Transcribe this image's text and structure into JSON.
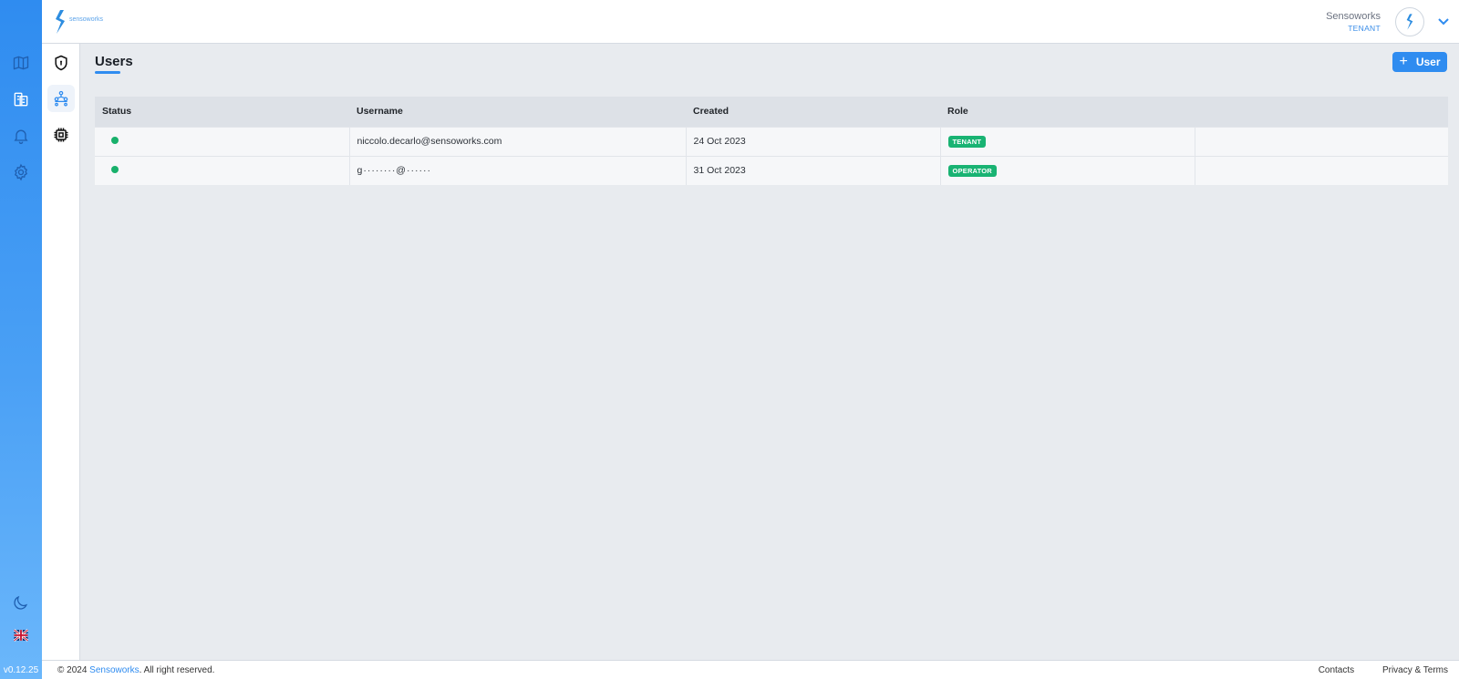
{
  "app": {
    "brand": "sensoworks",
    "version": "v0.12.25"
  },
  "rail": {
    "items": [
      {
        "icon": "map-icon"
      },
      {
        "icon": "buildings-icon"
      },
      {
        "icon": "bell-icon"
      },
      {
        "icon": "settings-gear-icon"
      }
    ],
    "bottom": [
      {
        "icon": "moon-icon"
      },
      {
        "icon": "uk-flag-icon"
      }
    ]
  },
  "subnav": {
    "items": [
      {
        "icon": "shield-icon"
      },
      {
        "icon": "users-network-icon",
        "active": true
      },
      {
        "icon": "chip-icon"
      }
    ]
  },
  "header": {
    "user_name": "Sensoworks",
    "user_role": "TENANT"
  },
  "page": {
    "title": "Users",
    "add_button_label": "User"
  },
  "table": {
    "columns": [
      "Status",
      "Username",
      "Created",
      "Role",
      ""
    ],
    "rows": [
      {
        "status": "active",
        "username": "niccolo.decarlo@sensoworks.com",
        "created": "24 Oct 2023",
        "role": "TENANT"
      },
      {
        "status": "active",
        "username": "g········@······",
        "created": "31 Oct 2023",
        "role": "OPERATOR"
      }
    ]
  },
  "footer": {
    "copyright_prefix": "© 2024 ",
    "copyright_brand": "Sensoworks",
    "copyright_suffix": ". All right reserved.",
    "contacts": "Contacts",
    "privacy": "Privacy & Terms"
  },
  "colors": {
    "primary": "#2f8cf0",
    "status_active": "#18b06b",
    "badge": "#19b373"
  }
}
